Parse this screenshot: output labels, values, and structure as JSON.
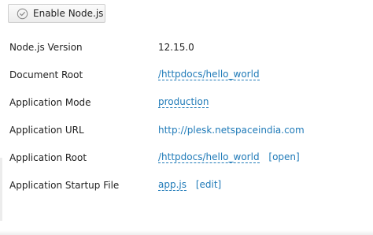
{
  "toolbar": {
    "enable_button_label": "Enable Node.js",
    "enable_button_icon": "check-circle-icon"
  },
  "details": {
    "rows": [
      {
        "label": "Node.js Version",
        "value": "12.15.0"
      },
      {
        "label": "Document Root",
        "value": "/httpdocs/hello_world"
      },
      {
        "label": "Application Mode",
        "value": "production"
      },
      {
        "label": "Application URL",
        "value": "http://plesk.netspaceindia.com"
      },
      {
        "label": "Application Root",
        "value": "/httpdocs/hello_world",
        "action": "[open]"
      },
      {
        "label": "Application Startup File",
        "value": "app.js",
        "action": "[edit]"
      }
    ]
  },
  "colors": {
    "link": "#1f7ab8",
    "text": "#222222"
  }
}
